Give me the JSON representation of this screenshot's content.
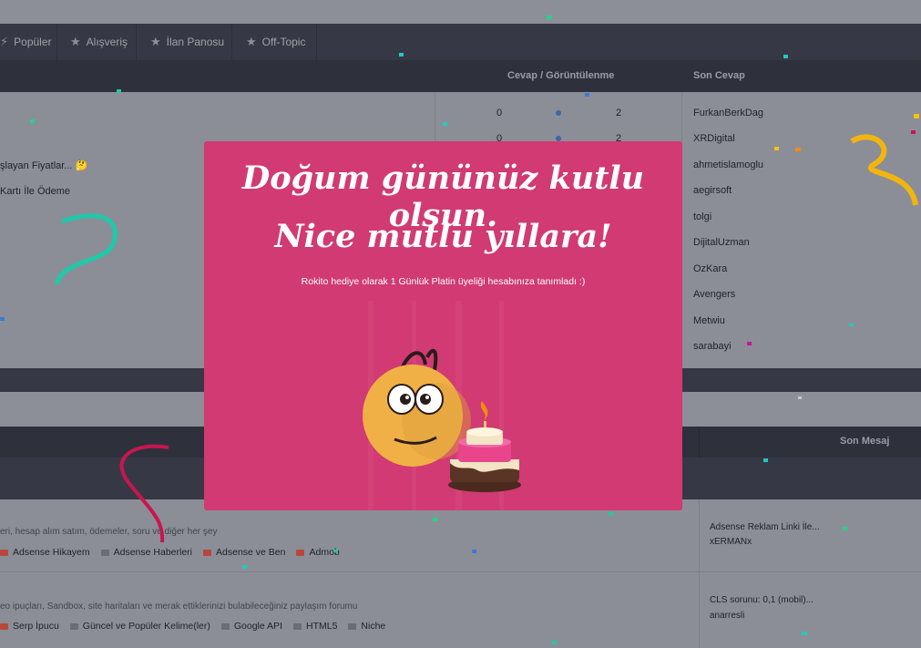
{
  "nav": {
    "items": [
      {
        "label": "Popüler",
        "icon": "trending-icon"
      },
      {
        "label": "Alışveriş",
        "icon": "star-icon"
      },
      {
        "label": "İlan Panosu",
        "icon": "star-icon"
      },
      {
        "label": "Off-Topic",
        "icon": "star-icon"
      }
    ]
  },
  "thread_table": {
    "col_replies_views": "Cevap / Görüntülenme",
    "col_last_reply": "Son Cevap",
    "threads": [
      {
        "title": "şlayan Fiyatlar... 🤔"
      },
      {
        "title": "Kartı İle Ödeme"
      }
    ],
    "rows": [
      {
        "replies": "0",
        "views": "2",
        "last_user": "FurkanBerkDag"
      },
      {
        "replies": "0",
        "views": "2",
        "last_user": "XRDigital"
      },
      {
        "last_user": "ahmetislamoglu"
      },
      {
        "last_user": "aegirsoft"
      },
      {
        "last_user": "tolgi"
      },
      {
        "last_user": "DijitalUzman"
      },
      {
        "last_user": "OzKara"
      },
      {
        "last_user": "Avengers"
      },
      {
        "last_user": "Metwiu"
      },
      {
        "last_user": "sarabayi"
      }
    ]
  },
  "forum_table": {
    "col_last_message": "Son Mesaj",
    "forums": [
      {
        "description": "eri, hesap alım satım, ödemeler, soru ve diğer her şey",
        "subforums": [
          "Adsense Hikayem",
          "Adsense Haberleri",
          "Adsense ve Ben",
          "Admob"
        ],
        "last_title": "Adsense Reklam Linki İle...",
        "last_user": "xERMANx"
      },
      {
        "description": "eo ipuçları, Sandbox, site haritaları ve merak ettiklerinizi bulabileceğiniz paylaşım forumu",
        "subforums": [
          "Serp İpucu",
          "Güncel ve Popüler Kelime(ler)",
          "Google API",
          "HTML5",
          "Niche"
        ],
        "last_title": "CLS sorunu: 0,1 (mobil)...",
        "last_user": "anarresli"
      }
    ]
  },
  "modal": {
    "title_line1": "Doğum gününüz kutlu olsun.",
    "title_line2": "Nice mutlu yıllara!",
    "message": "Rokito hediye olarak 1 Günlük Platin üyeliği hesabınıza tanımladı :)",
    "illustration": "birthday-mascot-with-cake",
    "background_color": "#d13a72"
  }
}
